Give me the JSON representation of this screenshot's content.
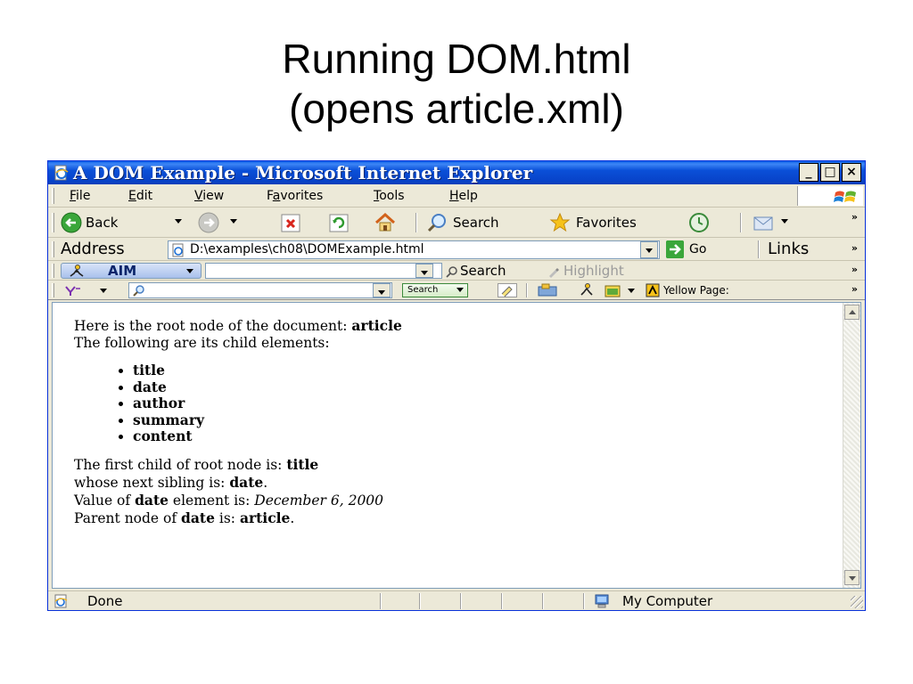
{
  "slide": {
    "title_line1": "Running DOM.html",
    "title_line2": "(opens article.xml)"
  },
  "window": {
    "title": "A DOM Example - Microsoft Internet Explorer",
    "minimize_glyph": "_",
    "maximize_glyph": "□",
    "close_glyph": "×"
  },
  "menu": {
    "items": [
      {
        "label": "File",
        "accel": "F"
      },
      {
        "label": "Edit",
        "accel": "E"
      },
      {
        "label": "View",
        "accel": "V"
      },
      {
        "label": "Favorites",
        "accel": "a"
      },
      {
        "label": "Tools",
        "accel": "T"
      },
      {
        "label": "Help",
        "accel": "H"
      }
    ]
  },
  "toolbar": {
    "back_label": "Back",
    "search_label": "Search",
    "favorites_label": "Favorites",
    "chevron": "»"
  },
  "address": {
    "label": "Address",
    "value": "D:\\examples\\ch08\\DOMExample.html",
    "go_label": "Go",
    "links_label": "Links"
  },
  "aim": {
    "label": "AIM",
    "search_label": "Search",
    "highlight_label": "Highlight"
  },
  "yahoo": {
    "search_label": "Search",
    "yellow_pages_label": "Yellow Page:"
  },
  "content": {
    "line1_prefix": "Here is the root node of the document: ",
    "root_node": "article",
    "line2": "The following are its child elements:",
    "children": [
      "title",
      "date",
      "author",
      "summary",
      "content"
    ],
    "first_child_prefix": "The first child of root node is: ",
    "first_child": "title",
    "sibling_prefix": "whose next sibling is: ",
    "sibling": "date",
    "sibling_suffix": ".",
    "value_prefix": "Value of ",
    "value_element": "date",
    "value_mid": " element is: ",
    "value_text": "December 6, 2000",
    "parent_prefix": "Parent node of ",
    "parent_element": "date",
    "parent_mid": " is: ",
    "parent_value": "article",
    "parent_suffix": "."
  },
  "status": {
    "text": "Done",
    "zone": "My Computer"
  },
  "colors": {
    "titlebar": "#0a4fd8",
    "chrome": "#ece9d8",
    "go_green": "#3aa63a"
  },
  "icons": [
    "ie-page-icon",
    "back-arrow-icon",
    "forward-arrow-icon",
    "stop-icon",
    "refresh-icon",
    "home-icon",
    "search-icon",
    "favorites-star-icon",
    "history-icon",
    "mail-icon",
    "windows-flag-icon",
    "aim-runner-icon",
    "magnifier-icon",
    "highlighter-icon",
    "yahoo-icon",
    "my-computer-icon"
  ]
}
